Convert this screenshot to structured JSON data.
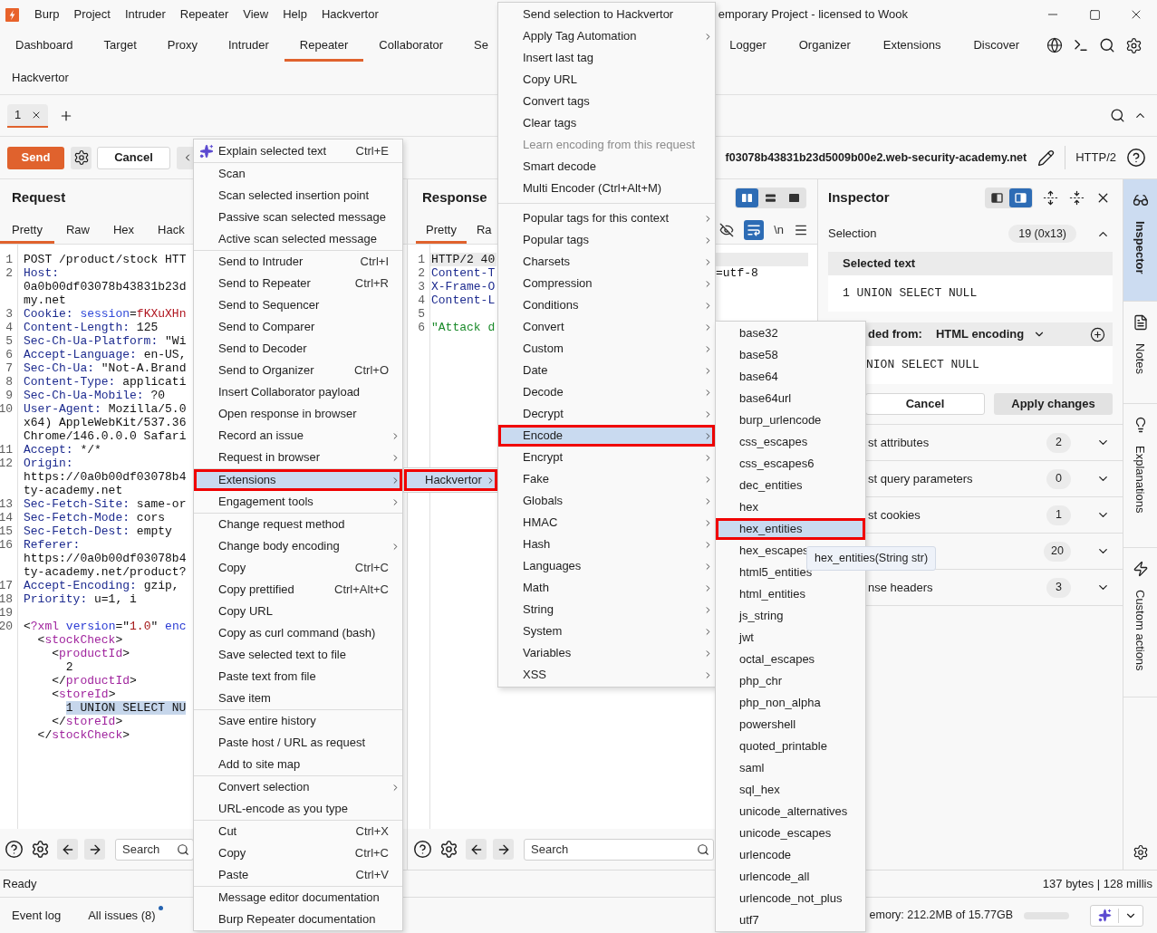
{
  "title_bar": {
    "menus": [
      "Burp",
      "Project",
      "Intruder",
      "Repeater",
      "View",
      "Help",
      "Hackvertor"
    ],
    "title": "emporary Project - licensed to Wook"
  },
  "main_tabs": [
    {
      "label": "Dashboard",
      "selected": false
    },
    {
      "label": "Target",
      "selected": false
    },
    {
      "label": "Proxy",
      "selected": false
    },
    {
      "label": "Intruder",
      "selected": false
    },
    {
      "label": "Repeater",
      "selected": true
    },
    {
      "label": "Collaborator",
      "selected": false
    },
    {
      "label": "Se",
      "selected": false
    },
    {
      "label": "Logger",
      "selected": false
    },
    {
      "label": "Organizer",
      "selected": false
    },
    {
      "label": "Extensions",
      "selected": false
    },
    {
      "label": "Discover",
      "selected": false
    }
  ],
  "extension_tabs": [
    {
      "label": "Hackvertor",
      "selected": false
    }
  ],
  "repeater_tabs": [
    {
      "label": "1",
      "selected": true
    }
  ],
  "toolbar": {
    "send": "Send",
    "cancel": "Cancel",
    "target": "f03078b43831b23d5009b00e2.web-security-academy.net",
    "protocol": "HTTP/2"
  },
  "request": {
    "title": "Request",
    "tabs": [
      {
        "label": "Pretty",
        "selected": true
      },
      {
        "label": "Raw",
        "selected": false
      },
      {
        "label": "Hex",
        "selected": false
      },
      {
        "label": "Hack",
        "selected": false
      }
    ],
    "lines": [
      {
        "number": "1",
        "segments": [
          {
            "kind": "plain",
            "text": "POST /product/stock HTT"
          }
        ]
      },
      {
        "number": "2",
        "segments": [
          {
            "kind": "header",
            "text": "Host:"
          }
        ]
      },
      {
        "segments": [
          {
            "kind": "plain",
            "text": "0a0b00df03078b43831b23d"
          }
        ]
      },
      {
        "segments": [
          {
            "kind": "plain",
            "text": "my.net"
          }
        ]
      },
      {
        "number": "3",
        "segments": [
          {
            "kind": "header",
            "text": "Cookie:"
          },
          {
            "kind": "cookie_name",
            "text": " session"
          },
          {
            "kind": "plain",
            "text": "="
          },
          {
            "kind": "cookie_value",
            "text": "fKXuXHn"
          }
        ]
      },
      {
        "number": "4",
        "segments": [
          {
            "kind": "header",
            "text": "Content-Length:"
          },
          {
            "kind": "plain",
            "text": " 125"
          }
        ]
      },
      {
        "number": "5",
        "segments": [
          {
            "kind": "header",
            "text": "Sec-Ch-Ua-Platform:"
          },
          {
            "kind": "plain",
            "text": " \"Wi"
          }
        ]
      },
      {
        "number": "6",
        "segments": [
          {
            "kind": "header",
            "text": "Accept-Language:"
          },
          {
            "kind": "plain",
            "text": " en-US,"
          }
        ]
      },
      {
        "number": "7",
        "segments": [
          {
            "kind": "header",
            "text": "Sec-Ch-Ua:"
          },
          {
            "kind": "plain",
            "text": " \"Not-A.Brand"
          }
        ]
      },
      {
        "number": "8",
        "segments": [
          {
            "kind": "header",
            "text": "Content-Type:"
          },
          {
            "kind": "plain",
            "text": " applicati"
          }
        ]
      },
      {
        "number": "9",
        "segments": [
          {
            "kind": "header",
            "text": "Sec-Ch-Ua-Mobile:"
          },
          {
            "kind": "plain",
            "text": " ?0"
          }
        ]
      },
      {
        "number": "10",
        "segments": [
          {
            "kind": "header",
            "text": "User-Agent:"
          },
          {
            "kind": "plain",
            "text": " Mozilla/5.0"
          }
        ]
      },
      {
        "segments": [
          {
            "kind": "plain",
            "text": "x64) AppleWebKit/537.36"
          }
        ]
      },
      {
        "segments": [
          {
            "kind": "plain",
            "text": "Chrome/146.0.0.0 Safari"
          }
        ]
      },
      {
        "number": "11",
        "segments": [
          {
            "kind": "header",
            "text": "Accept:"
          },
          {
            "kind": "plain",
            "text": " */*"
          }
        ]
      },
      {
        "number": "12",
        "segments": [
          {
            "kind": "header",
            "text": "Origin:"
          }
        ]
      },
      {
        "segments": [
          {
            "kind": "plain",
            "text": "https://0a0b00df03078b4"
          }
        ]
      },
      {
        "segments": [
          {
            "kind": "plain",
            "text": "ty-academy.net"
          }
        ]
      },
      {
        "number": "13",
        "segments": [
          {
            "kind": "header",
            "text": "Sec-Fetch-Site:"
          },
          {
            "kind": "plain",
            "text": " same-or"
          }
        ]
      },
      {
        "number": "14",
        "segments": [
          {
            "kind": "header",
            "text": "Sec-Fetch-Mode:"
          },
          {
            "kind": "plain",
            "text": " cors"
          }
        ]
      },
      {
        "number": "15",
        "segments": [
          {
            "kind": "header",
            "text": "Sec-Fetch-Dest:"
          },
          {
            "kind": "plain",
            "text": " empty"
          }
        ]
      },
      {
        "number": "16",
        "segments": [
          {
            "kind": "header",
            "text": "Referer:"
          }
        ]
      },
      {
        "segments": [
          {
            "kind": "plain",
            "text": "https://0a0b00df03078b4"
          }
        ]
      },
      {
        "segments": [
          {
            "kind": "plain",
            "text": "ty-academy.net/product?"
          }
        ]
      },
      {
        "number": "17",
        "segments": [
          {
            "kind": "header",
            "text": "Accept-Encoding:"
          },
          {
            "kind": "plain",
            "text": " gzip,"
          }
        ]
      },
      {
        "number": "18",
        "segments": [
          {
            "kind": "header",
            "text": "Priority:"
          },
          {
            "kind": "plain",
            "text": " u=1, i"
          }
        ]
      },
      {
        "number": "19"
      },
      {
        "number": "20",
        "segments": [
          {
            "kind": "punct",
            "text": "<"
          },
          {
            "kind": "tag",
            "text": "?xml"
          },
          {
            "kind": "attribute",
            "text": " version"
          },
          {
            "kind": "punct",
            "text": "=\""
          },
          {
            "kind": "attr_value",
            "text": "1.0"
          },
          {
            "kind": "punct",
            "text": "\""
          },
          {
            "kind": "attribute",
            "text": " enc"
          }
        ],
        "children": [
          {
            "segments": [
              {
                "kind": "punct",
                "text": "<"
              },
              {
                "kind": "tag",
                "text": "stockCheck"
              },
              {
                "kind": "punct",
                "text": ">"
              }
            ],
            "children": [
              {
                "segments": [
                  {
                    "kind": "punct",
                    "text": "<"
                  },
                  {
                    "kind": "tag",
                    "text": "productId"
                  },
                  {
                    "kind": "punct",
                    "text": ">"
                  }
                ],
                "children": [
                  {
                    "segments": [
                      {
                        "kind": "plain",
                        "text": "2"
                      }
                    ]
                  }
                ]
              },
              {
                "segments": [
                  {
                    "kind": "punct",
                    "text": "</"
                  },
                  {
                    "kind": "tag",
                    "text": "productId"
                  },
                  {
                    "kind": "punct",
                    "text": ">"
                  }
                ]
              },
              {
                "segments": [
                  {
                    "kind": "punct",
                    "text": "<"
                  },
                  {
                    "kind": "tag",
                    "text": "storeId"
                  },
                  {
                    "kind": "punct",
                    "text": ">"
                  }
                ],
                "children": [
                  {
                    "segments": [
                      {
                        "kind": "selection",
                        "text": "1 UNION SELECT NU"
                      }
                    ]
                  }
                ]
              },
              {
                "segments": [
                  {
                    "kind": "punct",
                    "text": "</"
                  },
                  {
                    "kind": "tag",
                    "text": "storeId"
                  },
                  {
                    "kind": "punct",
                    "text": ">"
                  }
                ]
              }
            ]
          },
          {
            "segments": [
              {
                "kind": "punct",
                "text": "</"
              },
              {
                "kind": "tag",
                "text": "stockCheck"
              },
              {
                "kind": "punct",
                "text": ">"
              }
            ]
          }
        ]
      }
    ],
    "search": {
      "placeholder": "Search"
    }
  },
  "response": {
    "title": "Response",
    "layout_modes": [
      {
        "kind": "columns",
        "selected": true
      },
      {
        "kind": "rows",
        "selected": false
      },
      {
        "kind": "single",
        "selected": false
      }
    ],
    "tabs": [
      {
        "label": "Pretty",
        "selected": true
      },
      {
        "label": "Ra",
        "selected": false
      }
    ],
    "view_options": [
      {
        "kind": "hide_nonprinting",
        "on": false
      },
      {
        "kind": "wrap",
        "on": true
      },
      {
        "kind": "newlines",
        "label": "\\n",
        "on": false
      },
      {
        "kind": "menu"
      }
    ],
    "lines": [
      {
        "number": "1",
        "current": true,
        "segments": [
          {
            "kind": "plain",
            "text": "HTTP/2 40"
          }
        ]
      },
      {
        "number": "2",
        "current": false,
        "segments": [
          {
            "kind": "header",
            "text": "Content-T"
          }
        ],
        "right_segments": [
          {
            "kind": "plain",
            "text": "=utf-8"
          }
        ]
      },
      {
        "number": "3",
        "current": false,
        "segments": [
          {
            "kind": "header",
            "text": "X-Frame-O"
          }
        ]
      },
      {
        "number": "4",
        "current": false,
        "segments": [
          {
            "kind": "header",
            "text": "Content-L"
          }
        ]
      },
      {
        "number": "5",
        "current": false
      },
      {
        "number": "6",
        "current": false,
        "segments": [
          {
            "kind": "string",
            "text": "\"Attack d"
          }
        ]
      }
    ],
    "search": {
      "placeholder": "Search"
    }
  },
  "inspector": {
    "title": "Inspector",
    "layout_modes": [
      {
        "kind": "left",
        "selected": false
      },
      {
        "kind": "right",
        "selected": true
      }
    ],
    "selection": {
      "label": "Selection",
      "count": "19 (0x13)",
      "expanded": true,
      "heading": "Selected text",
      "value": "1 UNION SELECT NULL"
    },
    "decoded": {
      "label": "ded from:",
      "encoding": "HTML encoding",
      "value": "NION SELECT NULL"
    },
    "buttons": [
      {
        "kind": "secondary",
        "label": "Cancel"
      },
      {
        "kind": "primary",
        "label": "Apply changes"
      }
    ],
    "sections": [
      {
        "label": "st attributes",
        "count": "2",
        "expanded": false
      },
      {
        "label": "st query parameters",
        "count": "0",
        "expanded": false
      },
      {
        "label": "st cookies",
        "count": "1",
        "expanded": false
      },
      {
        "count": "20",
        "expanded": false
      },
      {
        "label": "nse headers",
        "count": "3",
        "expanded": false
      }
    ]
  },
  "sidebar_tabs": [
    {
      "kind": "inspector",
      "label": "Inspector",
      "selected": true
    },
    {
      "kind": "notes",
      "label": "Notes",
      "selected": false
    },
    {
      "kind": "explanations",
      "label": "Explanations",
      "selected": false
    },
    {
      "kind": "custom_actions",
      "label": "Custom actions",
      "selected": false
    }
  ],
  "status_bar": {
    "message": "Ready",
    "stats": "137 bytes | 128 millis"
  },
  "bottom_bar": {
    "tabs": [
      {
        "label": "Event log",
        "unread": false
      },
      {
        "label": "All issues (8)",
        "unread": true
      }
    ],
    "memory": "emory: 212.2MB of 15.77GB"
  },
  "context_menu": {
    "ai_item": {
      "label": "Explain selected text",
      "shortcut": "Ctrl+E",
      "selected": false
    },
    "groups": [
      {
        "items": [
          {
            "label": "Scan",
            "selected": false
          },
          {
            "label": "Scan selected insertion point",
            "selected": false
          },
          {
            "label": "Passive scan selected message",
            "selected": false
          },
          {
            "label": "Active scan selected message",
            "selected": false
          }
        ]
      },
      {
        "items": [
          {
            "label": "Send to Intruder",
            "shortcut": "Ctrl+I",
            "selected": false
          },
          {
            "label": "Send to Repeater",
            "shortcut": "Ctrl+R",
            "selected": false
          },
          {
            "label": "Send to Sequencer",
            "selected": false
          },
          {
            "label": "Send to Comparer",
            "selected": false
          },
          {
            "label": "Send to Decoder",
            "selected": false
          },
          {
            "label": "Send to Organizer",
            "shortcut": "Ctrl+O",
            "selected": false
          },
          {
            "label": "Insert Collaborator payload",
            "selected": false
          },
          {
            "label": "Open response in browser",
            "selected": false
          },
          {
            "label": "Record an issue",
            "submenu": true,
            "selected": false
          },
          {
            "label": "Request in browser",
            "submenu": true,
            "selected": false
          }
        ]
      },
      {
        "items": [
          {
            "label": "Extensions",
            "submenu": true,
            "selected": true
          },
          {
            "label": "Engagement tools",
            "submenu": true,
            "selected": false
          }
        ]
      },
      {
        "items": [
          {
            "label": "Change request method",
            "selected": false
          },
          {
            "label": "Change body encoding",
            "submenu": true,
            "selected": false
          },
          {
            "label": "Copy",
            "shortcut": "Ctrl+C",
            "selected": false
          },
          {
            "label": "Copy prettified",
            "shortcut": "Ctrl+Alt+C",
            "selected": false
          },
          {
            "label": "Copy URL",
            "selected": false
          },
          {
            "label": "Copy as curl command (bash)",
            "selected": false
          },
          {
            "label": "Save selected text to file",
            "selected": false
          },
          {
            "label": "Paste text from file",
            "selected": false
          },
          {
            "label": "Save item",
            "selected": false
          }
        ]
      },
      {
        "items": [
          {
            "label": "Save entire history",
            "selected": false
          },
          {
            "label": "Paste host / URL as request",
            "selected": false
          },
          {
            "label": "Add to site map",
            "selected": false
          }
        ]
      },
      {
        "items": [
          {
            "label": "Convert selection",
            "submenu": true,
            "selected": false
          },
          {
            "label": "URL-encode as you type",
            "selected": false
          }
        ]
      },
      {
        "items": [
          {
            "label": "Cut",
            "shortcut": "Ctrl+X",
            "selected": false
          },
          {
            "label": "Copy",
            "shortcut": "Ctrl+C",
            "selected": false
          },
          {
            "label": "Paste",
            "shortcut": "Ctrl+V",
            "selected": false
          }
        ]
      },
      {
        "items": [
          {
            "label": "Message editor documentation",
            "selected": false
          },
          {
            "label": "Burp Repeater documentation",
            "selected": false
          }
        ]
      }
    ]
  },
  "extensions_submenu": {
    "groups": [
      {
        "items": [
          {
            "label": "Hackvertor",
            "submenu": true,
            "selected": true
          }
        ]
      }
    ]
  },
  "hackvertor_menu": {
    "groups": [
      {
        "items": [
          {
            "label": "Send selection to Hackvertor",
            "selected": false,
            "disabled": false
          },
          {
            "label": "Apply Tag Automation",
            "submenu": true,
            "selected": false,
            "disabled": false
          },
          {
            "label": "Insert last tag",
            "selected": false,
            "disabled": false
          },
          {
            "label": "Copy URL",
            "selected": false,
            "disabled": false
          },
          {
            "label": "Convert tags",
            "selected": false,
            "disabled": false
          },
          {
            "label": "Clear tags",
            "selected": false,
            "disabled": false
          },
          {
            "label": "Learn encoding from this request",
            "selected": false,
            "disabled": true
          },
          {
            "label": "Smart decode",
            "selected": false,
            "disabled": false
          },
          {
            "label": "Multi Encoder (Ctrl+Alt+M)",
            "selected": false,
            "disabled": false
          }
        ]
      },
      {
        "items": [
          {
            "label": "Popular tags for this context",
            "submenu": true,
            "selected": false,
            "disabled": false
          },
          {
            "label": "Popular tags",
            "submenu": true,
            "selected": false,
            "disabled": false
          },
          {
            "label": "Charsets",
            "submenu": true,
            "selected": false,
            "disabled": false
          },
          {
            "label": "Compression",
            "submenu": true,
            "selected": false,
            "disabled": false
          },
          {
            "label": "Conditions",
            "submenu": true,
            "selected": false,
            "disabled": false
          },
          {
            "label": "Convert",
            "submenu": true,
            "selected": false,
            "disabled": false
          },
          {
            "label": "Custom",
            "submenu": true,
            "selected": false,
            "disabled": false
          },
          {
            "label": "Date",
            "submenu": true,
            "selected": false,
            "disabled": false
          },
          {
            "label": "Decode",
            "submenu": true,
            "selected": false,
            "disabled": false
          },
          {
            "label": "Decrypt",
            "submenu": true,
            "selected": false,
            "disabled": false
          },
          {
            "label": "Encode",
            "submenu": true,
            "selected": true,
            "disabled": false
          },
          {
            "label": "Encrypt",
            "submenu": true,
            "selected": false,
            "disabled": false
          },
          {
            "label": "Fake",
            "submenu": true,
            "selected": false,
            "disabled": false
          },
          {
            "label": "Globals",
            "submenu": true,
            "selected": false,
            "disabled": false
          },
          {
            "label": "HMAC",
            "submenu": true,
            "selected": false,
            "disabled": false
          },
          {
            "label": "Hash",
            "submenu": true,
            "selected": false,
            "disabled": false
          },
          {
            "label": "Languages",
            "submenu": true,
            "selected": false,
            "disabled": false
          },
          {
            "label": "Math",
            "submenu": true,
            "selected": false,
            "disabled": false
          },
          {
            "label": "String",
            "submenu": true,
            "selected": false,
            "disabled": false
          },
          {
            "label": "System",
            "submenu": true,
            "selected": false,
            "disabled": false
          },
          {
            "label": "Variables",
            "submenu": true,
            "selected": false,
            "disabled": false
          },
          {
            "label": "XSS",
            "submenu": true,
            "selected": false,
            "disabled": false
          }
        ]
      }
    ]
  },
  "encode_menu": {
    "groups": [
      {
        "items": [
          {
            "label": "base32",
            "selected": false
          },
          {
            "label": "base58",
            "selected": false
          },
          {
            "label": "base64",
            "selected": false
          },
          {
            "label": "base64url",
            "selected": false
          },
          {
            "label": "burp_urlencode",
            "selected": false
          },
          {
            "label": "css_escapes",
            "selected": false
          },
          {
            "label": "css_escapes6",
            "selected": false
          },
          {
            "label": "dec_entities",
            "selected": false
          },
          {
            "label": "hex",
            "selected": false
          },
          {
            "label": "hex_entities",
            "selected": true
          },
          {
            "label": "hex_escapes",
            "selected": false
          },
          {
            "label": "html5_entities",
            "selected": false
          },
          {
            "label": "html_entities",
            "selected": false
          },
          {
            "label": "js_string",
            "selected": false
          },
          {
            "label": "jwt",
            "selected": false
          },
          {
            "label": "octal_escapes",
            "selected": false
          },
          {
            "label": "php_chr",
            "selected": false
          },
          {
            "label": "php_non_alpha",
            "selected": false
          },
          {
            "label": "powershell",
            "selected": false
          },
          {
            "label": "quoted_printable",
            "selected": false
          },
          {
            "label": "saml",
            "selected": false
          },
          {
            "label": "sql_hex",
            "selected": false
          },
          {
            "label": "unicode_alternatives",
            "selected": false
          },
          {
            "label": "unicode_escapes",
            "selected": false
          },
          {
            "label": "urlencode",
            "selected": false
          },
          {
            "label": "urlencode_all",
            "selected": false
          },
          {
            "label": "urlencode_not_plus",
            "selected": false
          },
          {
            "label": "utf7",
            "selected": false
          }
        ]
      }
    ]
  },
  "tooltip": {
    "text": "hex_entities(String str)"
  }
}
